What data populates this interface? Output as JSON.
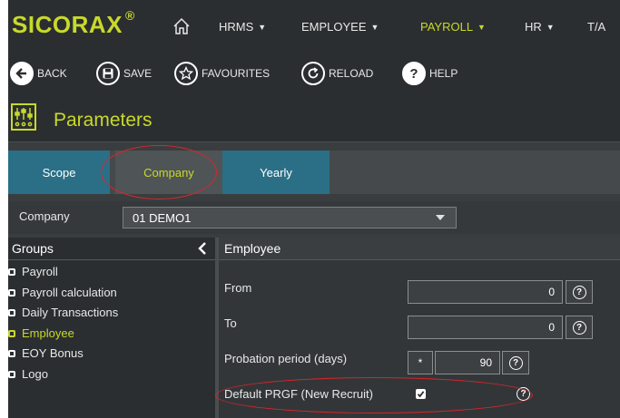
{
  "app": {
    "brand": "SICORAX",
    "brand_mark": "®"
  },
  "menu": [
    {
      "label": "HRMS"
    },
    {
      "label": "EMPLOYEE"
    },
    {
      "label": "PAYROLL",
      "active": true
    },
    {
      "label": "HR"
    },
    {
      "label": "T/A"
    }
  ],
  "toolbar": {
    "back": "BACK",
    "save": "SAVE",
    "favourites": "FAVOURITES",
    "reload": "RELOAD",
    "help": "HELP"
  },
  "page": {
    "title": "Parameters"
  },
  "tabs": [
    "Scope",
    "Company",
    "Yearly"
  ],
  "company": {
    "label": "Company",
    "value": "01 DEMO1"
  },
  "groups": {
    "title": "Groups",
    "items": [
      "Payroll",
      "Payroll calculation",
      "Daily Transactions",
      "Employee",
      "EOY Bonus",
      "Logo"
    ],
    "active_index": 3
  },
  "detail": {
    "title": "Employee",
    "fields": {
      "from": {
        "label": "From",
        "value": "0"
      },
      "to": {
        "label": "To",
        "value": "0"
      },
      "probation": {
        "label": "Probation period (days)",
        "prefix": "*",
        "value": "90"
      },
      "prgf": {
        "label": "Default PRGF (New Recruit)",
        "checked": true
      }
    },
    "help_glyph": "?"
  },
  "colors": {
    "accent": "#c8d92a",
    "tab_teal": "#2a6f86",
    "annotation": "#d9262c"
  }
}
